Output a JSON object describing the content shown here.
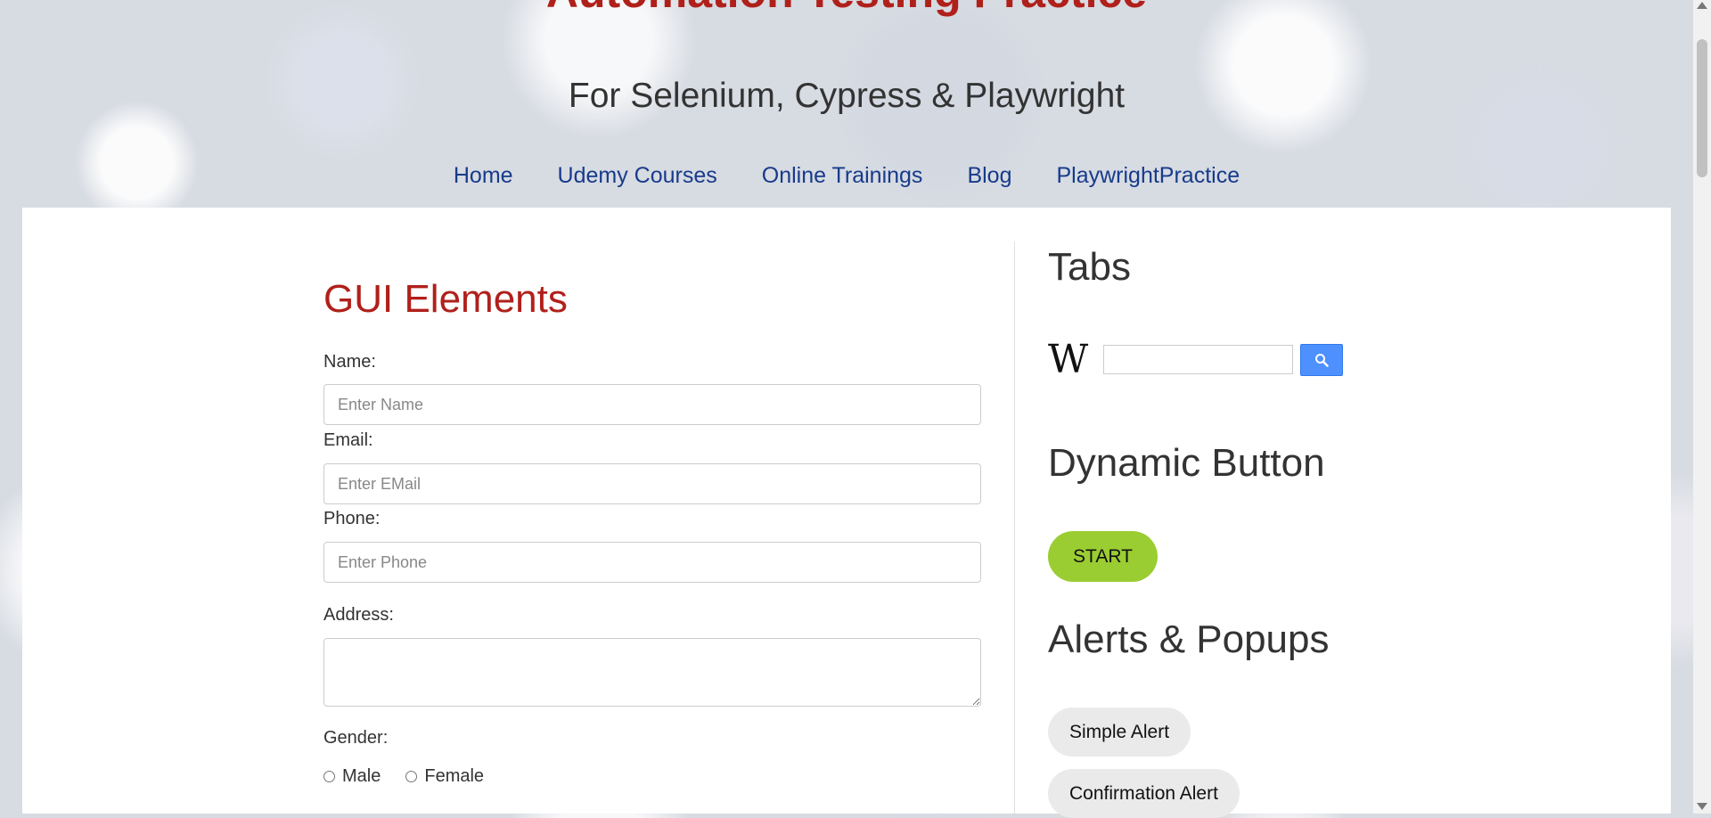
{
  "banner": {
    "title": "Automation Testing Practice",
    "subtitle": "For Selenium, Cypress & Playwright"
  },
  "nav": {
    "items": [
      {
        "label": "Home"
      },
      {
        "label": "Udemy Courses"
      },
      {
        "label": "Online Trainings"
      },
      {
        "label": "Blog"
      },
      {
        "label": "PlaywrightPractice"
      }
    ]
  },
  "gui": {
    "title": "GUI Elements",
    "name_label": "Name:",
    "name_placeholder": "Enter Name",
    "email_label": "Email:",
    "email_placeholder": "Enter EMail",
    "phone_label": "Phone:",
    "phone_placeholder": "Enter Phone",
    "address_label": "Address:",
    "gender_label": "Gender:",
    "gender_options": [
      "Male",
      "Female"
    ]
  },
  "sidebar": {
    "tabs_title": "Tabs",
    "wiki_logo": "W",
    "dynamic_title": "Dynamic Button",
    "start_label": "START",
    "alerts_title": "Alerts & Popups",
    "simple_alert_label": "Simple Alert",
    "confirmation_alert_label": "Confirmation Alert"
  },
  "colors": {
    "title_red": "#b0201a",
    "nav_blue": "#173b8a",
    "start_green": "#9acd32",
    "search_blue": "#4d90fe"
  }
}
